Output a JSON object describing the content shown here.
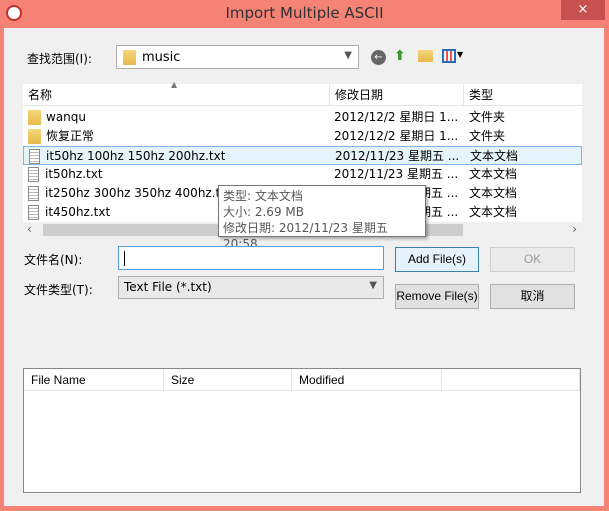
{
  "window": {
    "title": "Import Multiple ASCII",
    "close_icon": "×"
  },
  "lookin": {
    "label": "查找范围(I):",
    "value": "music"
  },
  "toolbar": {
    "back": "back-icon",
    "up": "up-folder-icon",
    "new_folder": "new-folder-icon",
    "view": "view-menu-icon"
  },
  "columns": [
    "名称",
    "修改日期",
    "类型"
  ],
  "files": [
    {
      "name": "wanqu",
      "date": "2012/12/2 星期日 1...",
      "type": "文件夹",
      "kind": "folder"
    },
    {
      "name": "恢复正常",
      "date": "2012/12/2 星期日 1...",
      "type": "文件夹",
      "kind": "folder"
    },
    {
      "name": "it50hz 100hz 150hz 200hz.txt",
      "date": "2012/11/23 星期五 ...",
      "type": "文本文档",
      "kind": "file",
      "selected": true
    },
    {
      "name": "it50hz.txt",
      "date": "2012/11/23 星期五 ...",
      "type": "文本文档",
      "kind": "file"
    },
    {
      "name": "it250hz 300hz 350hz 400hz.txt",
      "date": "2012/11/23 星期五 ...",
      "type": "文本文档",
      "kind": "file"
    },
    {
      "name": "it450hz.txt",
      "date": "2012/11/23 星期五 ...",
      "type": "文本文档",
      "kind": "file"
    }
  ],
  "tooltip": {
    "type": "类型: 文本文档",
    "size": "大小: 2.69 MB",
    "modified": "修改日期: 2012/11/23 星期五 20:58"
  },
  "filename": {
    "label": "文件名(N):",
    "value": ""
  },
  "filetype": {
    "label": "文件类型(T):",
    "value": "Text File (*.txt)"
  },
  "buttons": {
    "add": "Add File(s)",
    "ok": "OK",
    "remove": "Remove File(s)",
    "cancel": "取消"
  },
  "selected_list": {
    "columns": [
      "File Name",
      "Size",
      "Modified"
    ]
  }
}
